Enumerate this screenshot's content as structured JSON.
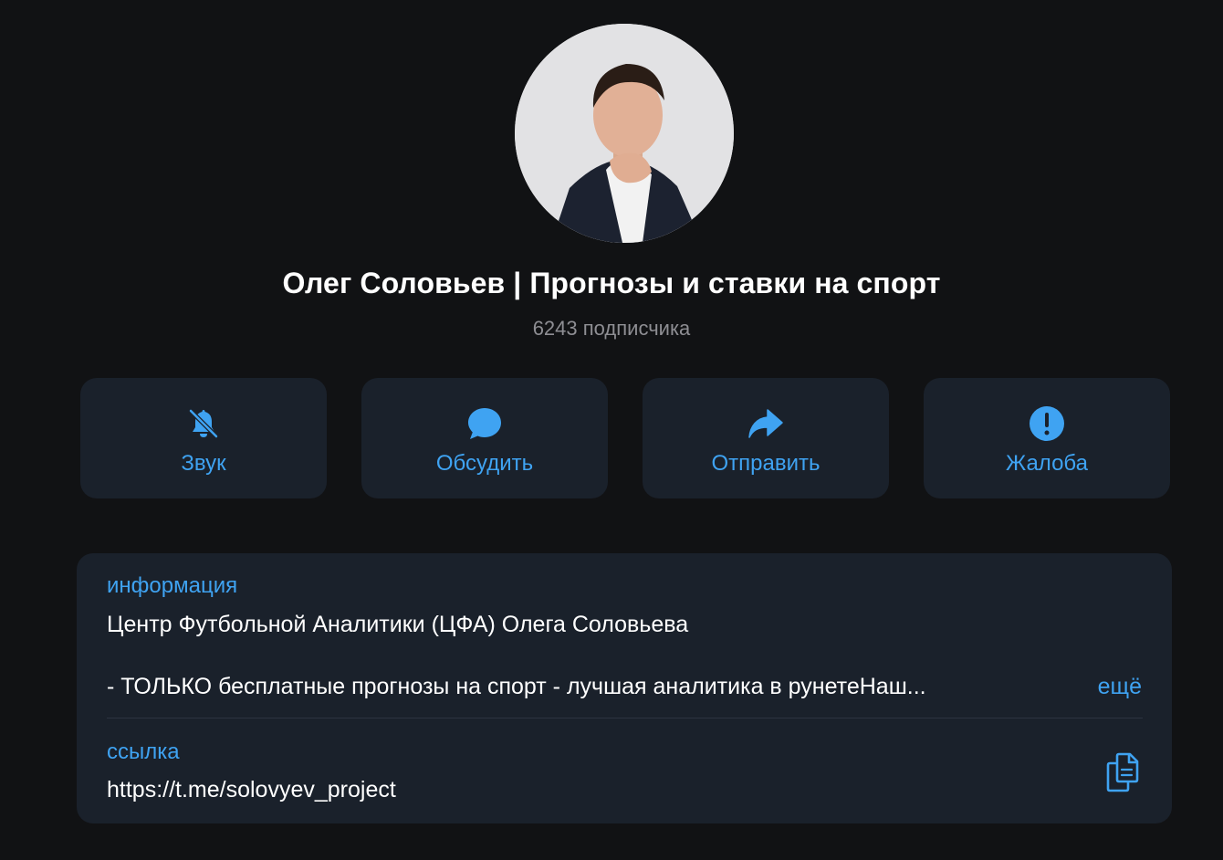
{
  "channel": {
    "title": "Олег Соловьев | Прогнозы и ставки на спорт",
    "subscribers": "6243 подписчика"
  },
  "actions": [
    {
      "label": "Звук",
      "icon": "bell-muted-icon"
    },
    {
      "label": "Обсудить",
      "icon": "chat-bubble-icon"
    },
    {
      "label": "Отправить",
      "icon": "share-arrow-icon"
    },
    {
      "label": "Жалоба",
      "icon": "exclamation-circle-icon"
    }
  ],
  "info": {
    "header": "информация",
    "line1": "Центр Футбольной Аналитики (ЦФА) Олега Соловьева",
    "line2": "- ТОЛЬКО бесплатные прогнозы на спорт - лучшая аналитика в рунетеНаш...",
    "more": "ещё"
  },
  "link": {
    "header": "ссылка",
    "value": "https://t.me/solovyev_project"
  },
  "colors": {
    "background": "#111214",
    "card": "#1a212b",
    "accent": "#3fa3f2",
    "muted": "#8e8e93"
  }
}
